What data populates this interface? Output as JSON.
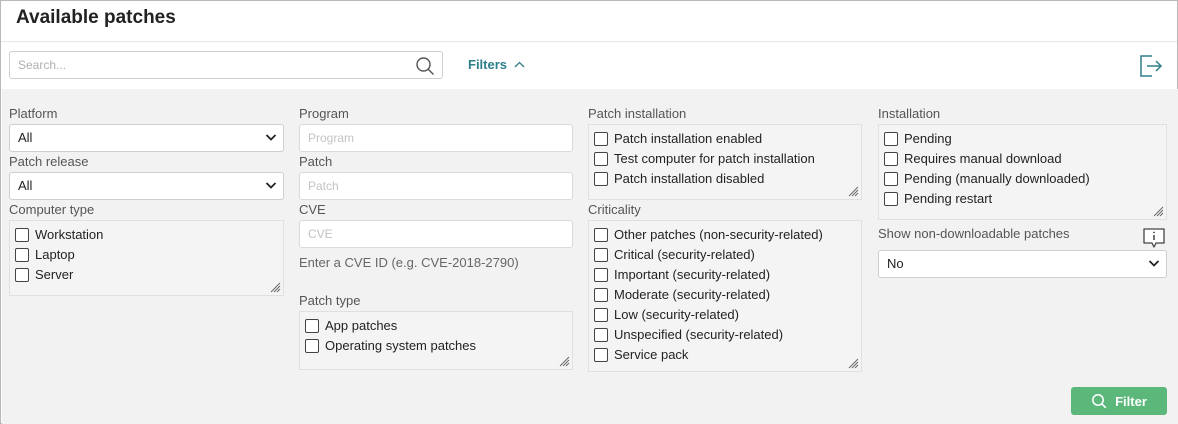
{
  "title": "Available patches",
  "search": {
    "placeholder": "Search..."
  },
  "filters_label": "Filters",
  "platform": {
    "label": "Platform",
    "value": "All"
  },
  "patch_release": {
    "label": "Patch release",
    "value": "All"
  },
  "computer_type": {
    "label": "Computer type",
    "options": [
      "Workstation",
      "Laptop",
      "Server"
    ]
  },
  "program": {
    "label": "Program",
    "placeholder": "Program"
  },
  "patch": {
    "label": "Patch",
    "placeholder": "Patch"
  },
  "cve": {
    "label": "CVE",
    "placeholder": "CVE",
    "hint": "Enter a CVE ID (e.g. CVE-2018-2790)"
  },
  "patch_type": {
    "label": "Patch type",
    "options": [
      "App patches",
      "Operating system patches"
    ]
  },
  "patch_installation": {
    "label": "Patch installation",
    "options": [
      "Patch installation enabled",
      "Test computer for patch installation",
      "Patch installation disabled"
    ]
  },
  "criticality": {
    "label": "Criticality",
    "options": [
      "Other patches (non-security-related)",
      "Critical (security-related)",
      "Important (security-related)",
      "Moderate (security-related)",
      "Low (security-related)",
      "Unspecified (security-related)",
      "Service pack"
    ]
  },
  "installation": {
    "label": "Installation",
    "options": [
      "Pending",
      "Requires manual download",
      "Pending (manually downloaded)",
      "Pending restart"
    ]
  },
  "non_downloadable": {
    "label": "Show non-downloadable patches",
    "value": "No"
  },
  "filter_button": "Filter",
  "colors": {
    "accent": "#2f7f8a",
    "button": "#5cb87a",
    "panel": "#f2f2f2"
  }
}
